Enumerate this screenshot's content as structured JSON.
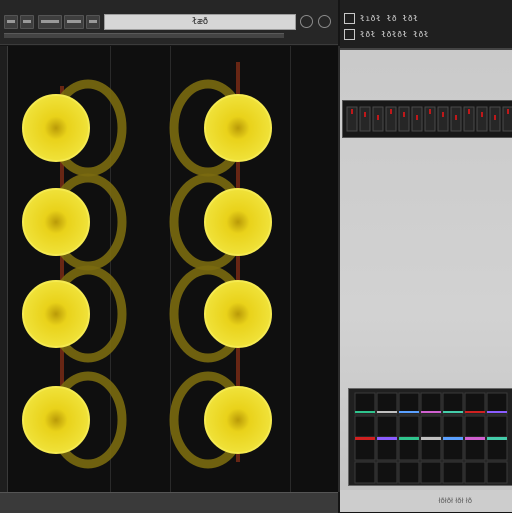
{
  "toolbar": {
    "title": "łæð",
    "button_count": 5
  },
  "canvas": {
    "columns": 2,
    "rows": 4,
    "node_color": "#e8d21c",
    "ring_color": "#7a6a10",
    "connector_color": "#b33a1a"
  },
  "panel": {
    "rows": [
      {
        "label": "łıðł łð łðł"
      },
      {
        "label": "łðł łðłðł łðł"
      }
    ],
    "footer": "łðłðł łðł łð"
  }
}
